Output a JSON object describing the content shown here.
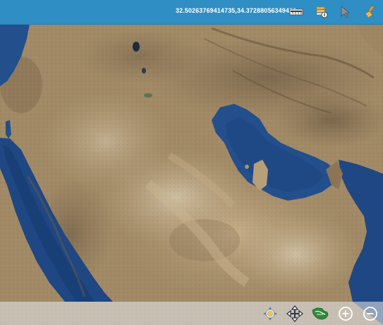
{
  "map": {
    "basemap": "satellite-imagery",
    "colors": {
      "water": "#234f8c",
      "deep_water": "#1a3f78",
      "land": "#a6906c",
      "desert": "#c3a882",
      "dark_terrain": "#6e5c45"
    }
  },
  "topbar": {
    "coordinates": "32.50263769414735,34.37288056349422",
    "background": "#2f8ec4",
    "tools": [
      {
        "name": "scale-ruler-icon"
      },
      {
        "name": "layers-info-icon"
      },
      {
        "name": "pointer-cursor-icon"
      },
      {
        "name": "eraser-brush-icon"
      }
    ]
  },
  "bottombar": {
    "controls": [
      {
        "name": "locate-icon"
      },
      {
        "name": "pan-move-icon"
      },
      {
        "name": "full-extent-map-icon"
      },
      {
        "name": "zoom-in-icon"
      },
      {
        "name": "zoom-out-icon"
      }
    ]
  }
}
